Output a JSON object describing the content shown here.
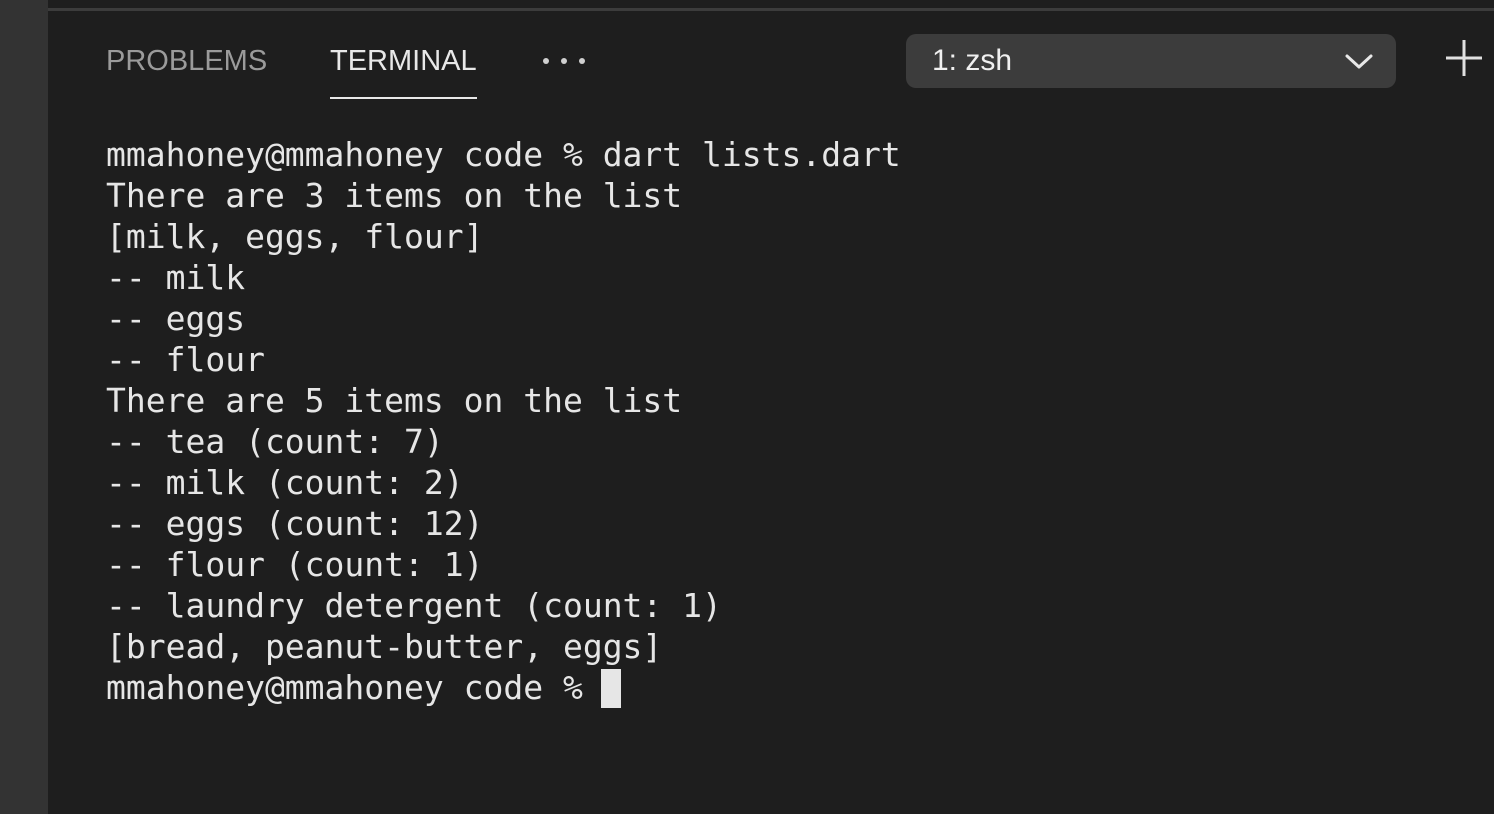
{
  "tabs": {
    "problems": "PROBLEMS",
    "terminal": "TERMINAL"
  },
  "terminal_selector": {
    "selected": "1: zsh"
  },
  "icons": {
    "more": "ellipsis-icon",
    "dropdown": "chevron-down-icon",
    "new_terminal": "plus-icon"
  },
  "colors": {
    "background": "#1e1e1e",
    "text": "#e6e6e6",
    "inactive_tab": "#9b9b9b",
    "select_bg": "#3c3c3c"
  },
  "terminal": {
    "lines": [
      "mmahoney@mmahoney code % dart lists.dart",
      "There are 3 items on the list",
      "[milk, eggs, flour]",
      "-- milk",
      "-- eggs",
      "-- flour",
      "There are 5 items on the list",
      "-- tea (count: 7)",
      "-- milk (count: 2)",
      "-- eggs (count: 12)",
      "-- flour (count: 1)",
      "-- laundry detergent (count: 1)",
      "[bread, peanut-butter, eggs]"
    ],
    "prompt": "mmahoney@mmahoney code %"
  }
}
